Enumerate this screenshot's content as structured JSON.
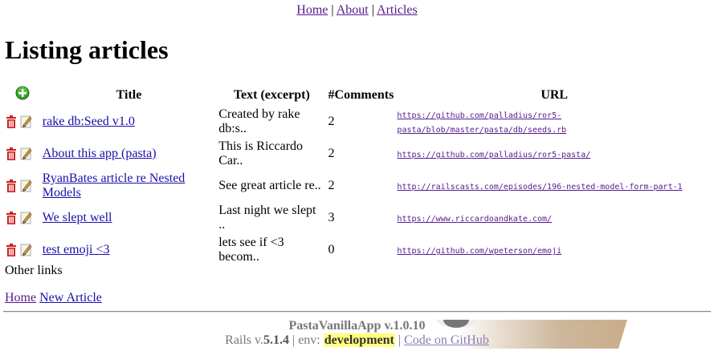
{
  "nav": {
    "home": "Home",
    "about": "About",
    "articles": "Articles",
    "sep": "|"
  },
  "page_title": "Listing articles",
  "table": {
    "headers": {
      "title": "Title",
      "text": "Text (excerpt)",
      "comments": "#Comments",
      "url": "URL"
    },
    "rows": [
      {
        "title": "rake db:Seed v1.0",
        "text": "Created by rake db:s..",
        "comments": "2",
        "url": "https://github.com/palladius/ror5-pasta/blob/master/pasta/db/seeds.rb"
      },
      {
        "title": "About this app (pasta)",
        "text": "This is Riccardo Car..",
        "comments": "2",
        "url": "https://github.com/palladius/ror5-pasta/"
      },
      {
        "title": "RyanBates article re Nested Models",
        "text": "See great article re..",
        "comments": "2",
        "url": "http://railscasts.com/episodes/196-nested-model-form-part-1"
      },
      {
        "title": "We slept well",
        "text": "Last night we slept ..",
        "comments": "3",
        "url": "https://www.riccardoandkate.com/"
      },
      {
        "title": "test emoji <3",
        "text": "lets see if <3 becom..",
        "comments": "0",
        "url": "https://github.com/wpeterson/emoji"
      }
    ]
  },
  "other_links": {
    "heading": "Other links",
    "home": "Home",
    "new_article": "New Article"
  },
  "footer": {
    "app_name": "PastaVanillaApp v.1.0.10",
    "rails_prefix": "Rails v.",
    "rails_version": "5.1.4",
    "env_label": " | env: ",
    "env_value": "development",
    "sep": " | ",
    "github_link": "Code on GitHub"
  },
  "icons": {
    "add": "add-icon",
    "delete": "trash-icon",
    "edit": "pencil-icon"
  },
  "colors": {
    "link": "#1a0dab",
    "visited": "#551a8b",
    "trash": "#cc1f1f",
    "add": "#3a9c2c",
    "env_highlight": "#ffff80"
  }
}
